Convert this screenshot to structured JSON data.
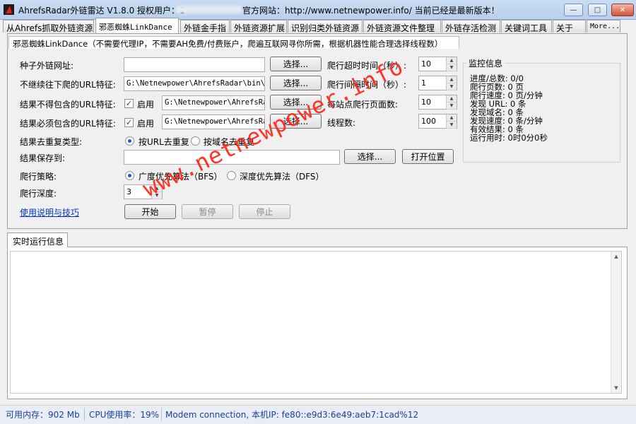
{
  "window": {
    "title": "AhrefsRadar外链雷达 V1.8.0 授权用户：1",
    "title_right": "官方网站：http://www.netnewpower.info/ 当前已经是最新版本！",
    "controls": {
      "minimize": "—",
      "maximize": "□",
      "close": "✕"
    }
  },
  "tabs": [
    {
      "label": "从Ahrefs抓取外链资源"
    },
    {
      "label": "邪恶蜘蛛LinkDance"
    },
    {
      "label": "外链金手指"
    },
    {
      "label": "外链资源扩展"
    },
    {
      "label": "识别归类外链资源"
    },
    {
      "label": "外链资源文件整理"
    },
    {
      "label": "外链存活检测"
    },
    {
      "label": "关键词工具"
    },
    {
      "label": "关于"
    },
    {
      "label": "More..."
    }
  ],
  "panel": {
    "header": "邪恶蜘蛛LinkDance（不需要代理IP，不需要AH免费/付费账户，爬遍互联网寻你所需，根据机器性能合理选择线程数）"
  },
  "form": {
    "seed_label": "种子外链网址:",
    "seed_value": "",
    "noncrawl_label": "不继续往下爬的URL特征:",
    "noncrawl_value": "G:\\Netnewpower\\AhrefsRadar\\bin\\x64\\De",
    "exclude_label": "结果不得包含的URL特征:",
    "exclude_value": "G:\\Netnewpower\\AhrefsRadar",
    "include_label": "结果必须包含的URL特征:",
    "include_value": "G:\\Netnewpower\\AhrefsRadar",
    "enable_label": "启用",
    "select_label": "选择...",
    "dedupe_label": "结果去重复类型:",
    "dedupe_options": [
      "按URL去重复",
      "按域名去重复"
    ],
    "save_label": "结果保存到:",
    "save_value": "",
    "open_location_label": "打开位置",
    "strategy_label": "爬行策略:",
    "strategy_options": [
      "广度优先算法（BFS）",
      "深度优先算法（DFS）"
    ],
    "depth_label": "爬行深度:",
    "depth_value": "3",
    "help_link": "使用说明与技巧",
    "start_label": "开始",
    "pause_label": "暂停",
    "stop_label": "停止",
    "timeout_label": "爬行超时时间（秒）:",
    "timeout_value": "10",
    "interval_label": "爬行间隔时间（秒）:",
    "interval_value": "1",
    "pages_per_site_label": "每站点爬行页面数:",
    "pages_per_site_value": "10",
    "threads_label": "线程数:",
    "threads_value": "100"
  },
  "monitor": {
    "title": "监控信息",
    "lines": [
      "进度/总数: 0/0",
      "爬行页数:  0 页",
      "爬行速度:  0 页/分钟",
      "发现 URL:  0 条",
      "发现域名:  0 条",
      "发现速度:  0 条/分钟",
      "有效结果:  0 条",
      "运行用时:  0时0分0秒"
    ]
  },
  "log": {
    "tab_label": "实时运行信息"
  },
  "status": {
    "memory": "可用内存：902 Mb",
    "cpu": "CPU使用率：19%",
    "network": "Modem connection,  本机IP: fe80::e9d3:6e49:aeb7:1cad%12"
  },
  "watermark": "www.netnewpower.info"
}
